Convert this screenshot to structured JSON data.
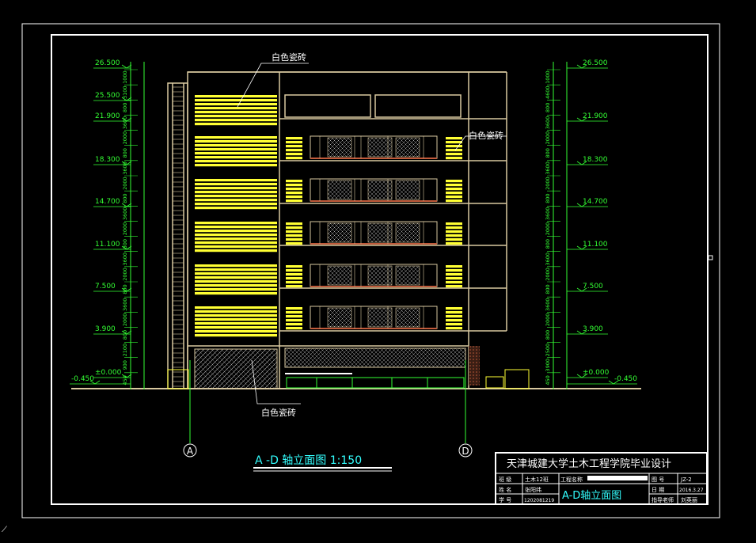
{
  "drawing": {
    "title": "A -D 轴立面图  1:150",
    "labels": {
      "tile_top": "白色瓷砖",
      "tile_right": "白色瓷砖",
      "tile_bottom": "白色瓷砖"
    },
    "axes": {
      "left": "A",
      "right": "D"
    },
    "levels_left": [
      "26.500",
      "25.500",
      "21.900",
      "18.300",
      "14.700",
      "11.100",
      "7.500",
      "3.900",
      "±0.000",
      "-0.450"
    ],
    "levels_right": [
      "26.500",
      "21.900",
      "18.300",
      "14.700",
      "11.100",
      "7.500",
      "3.900",
      "±0.000",
      "-0.450"
    ],
    "dims_left": [
      "1000",
      "3100",
      "800",
      "3600",
      "2000",
      "800",
      "3600",
      "2000",
      "800",
      "3600",
      "2000",
      "800",
      "3600",
      "2000",
      "800",
      "3600",
      "2000",
      "800",
      "2100",
      "900",
      "450"
    ],
    "dims_right": [
      "1000",
      "4600",
      "800",
      "3600",
      "2000",
      "800",
      "3600",
      "2000",
      "800",
      "3600",
      "2000",
      "800",
      "3600",
      "2000",
      "800",
      "3600",
      "2000",
      "800",
      "2500",
      "3900",
      "450"
    ]
  },
  "titleblock": {
    "school": "天津城建大学土木工程学院毕业设计",
    "class_label": "班  级",
    "class_value": "土木12班",
    "project_label": "工程名称",
    "name_label": "姓  名",
    "name_value": "张阳纬",
    "id_label": "学  号",
    "id_value": "1202081219",
    "sheet_title": "A-D轴立面图",
    "drawing_no_label": "图  号",
    "drawing_no": "JZ-2",
    "date_label": "日  期",
    "date": "2016.3.27",
    "advisor_label": "指导老师",
    "advisor": "刘英丽"
  },
  "colors": {
    "frame": "#ffffff",
    "dim": "#33ff33",
    "tile": "#ffff33",
    "outline": "#d9c9a0",
    "text": "#ffffff",
    "cyan": "#33ffff"
  }
}
